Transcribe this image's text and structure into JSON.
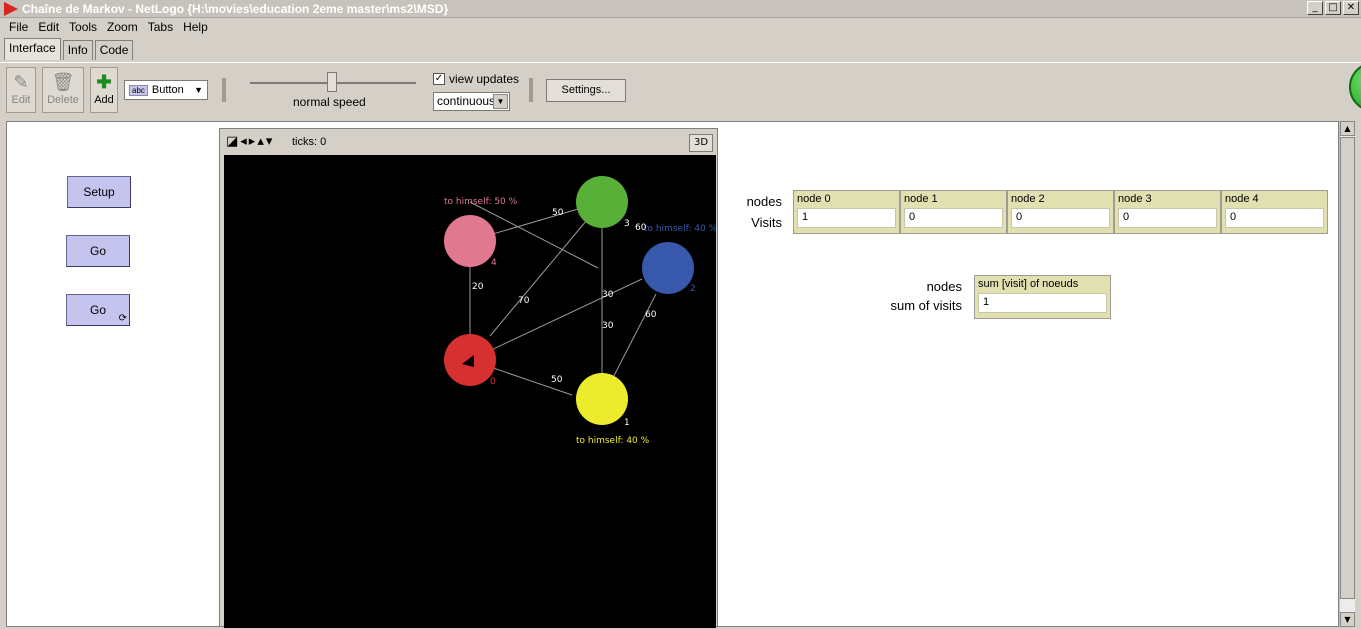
{
  "window": {
    "title": "Chaîne de Markov - NetLogo {H:\\movies\\education 2eme master\\ms2\\MSD}"
  },
  "menu": [
    "File",
    "Edit",
    "Tools",
    "Zoom",
    "Tabs",
    "Help"
  ],
  "tabs": [
    "Interface",
    "Info",
    "Code"
  ],
  "toolbar": {
    "edit": "Edit",
    "delete": "Delete",
    "add": "Add",
    "widget_type": "Button",
    "speed_label": "normal speed",
    "view_updates": "view updates",
    "update_mode": "continuous",
    "settings": "Settings..."
  },
  "buttons": {
    "setup": "Setup",
    "go": "Go",
    "go_forever": "Go"
  },
  "view": {
    "ticks": "ticks: 0",
    "three_d": "3D",
    "labels": {
      "n4_self": "to himself: 50 %",
      "n2_self": "to himself: 40 %",
      "n1_self": "to himself: 40 %",
      "n0": "0",
      "n1": "1",
      "n2": "2",
      "n3": "3",
      "n4": "4",
      "e_4_3": "50",
      "e_3_2": "60",
      "e_3_0": "70",
      "e_3_1": "30",
      "e_0_4": "20",
      "e_0_1": "50",
      "e_1_2": "60",
      "e_0_2": "30"
    },
    "colors": {
      "node0": "#d63030",
      "node1": "#ecec2c",
      "node2": "#3858ac",
      "node3": "#58b038",
      "node4": "#e07890"
    }
  },
  "monitors": {
    "row1_label": "nodes",
    "row2_label": "Visits",
    "items": [
      {
        "name": "node 0",
        "value": "1"
      },
      {
        "name": "node 1",
        "value": "0"
      },
      {
        "name": "node 2",
        "value": "0"
      },
      {
        "name": "node 3",
        "value": "0"
      },
      {
        "name": "node 4",
        "value": "0"
      }
    ],
    "sum_row1_label": "nodes",
    "sum_row2_label": "sum of visits",
    "sum": {
      "name": "sum [visit] of noeuds",
      "value": "1"
    }
  }
}
